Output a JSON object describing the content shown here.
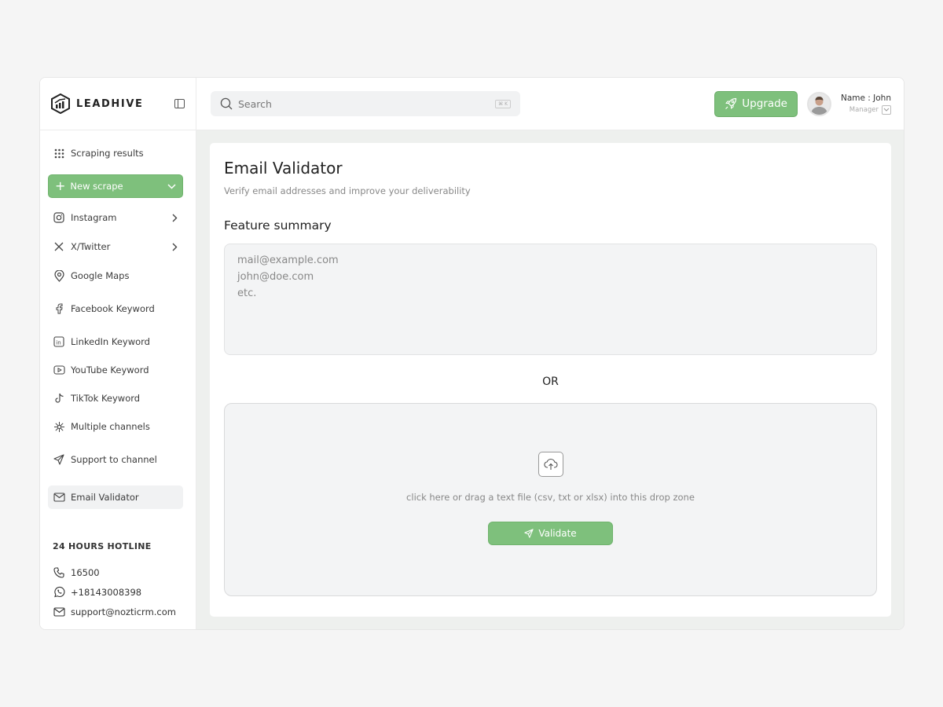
{
  "brand": {
    "name": "LEADHIVE"
  },
  "sidebar": {
    "items": [
      {
        "label": "Scraping results",
        "icon": "grid-dots-icon"
      },
      {
        "label": "New scrape",
        "icon": "plus-icon"
      },
      {
        "label": "Instagram",
        "icon": "instagram-icon"
      },
      {
        "label": "X/Twitter",
        "icon": "x-twitter-icon"
      },
      {
        "label": "Google Maps",
        "icon": "map-pin-icon"
      },
      {
        "label": "Facebook Keyword",
        "icon": "facebook-icon"
      },
      {
        "label": "LinkedIn Keyword",
        "icon": "linkedin-icon"
      },
      {
        "label": "YouTube Keyword",
        "icon": "youtube-icon"
      },
      {
        "label": "TikTok Keyword",
        "icon": "tiktok-icon"
      },
      {
        "label": "Multiple channels",
        "icon": "network-icon"
      },
      {
        "label": "Support to channel",
        "icon": "send-icon"
      },
      {
        "label": "Email Validator",
        "icon": "mail-icon"
      }
    ],
    "hotline": {
      "title": "24 HOURS HOTLINE",
      "phone": "16500",
      "whatsapp": "+18143008398",
      "email": "support@nozticrm.com"
    }
  },
  "topbar": {
    "search_placeholder": "Search",
    "search_shortcut": "⌘ K",
    "upgrade_label": "Upgrade",
    "user_name": "Name : John",
    "user_role": "Manager"
  },
  "main": {
    "title": "Email Validator",
    "subtitle": "Verify email addresses and improve your deliverability",
    "section_title": "Feature summary",
    "textarea_placeholder": "mail@example.com\njohn@doe.com\netc.",
    "or_label": "OR",
    "drop_hint": "click here or drag a text file (csv, txt or xlsx) into this drop zone",
    "validate_label": "Validate"
  },
  "colors": {
    "accent": "#7ec07c",
    "panel_bg": "#eef0ee",
    "field_bg": "#f3f4f5"
  }
}
